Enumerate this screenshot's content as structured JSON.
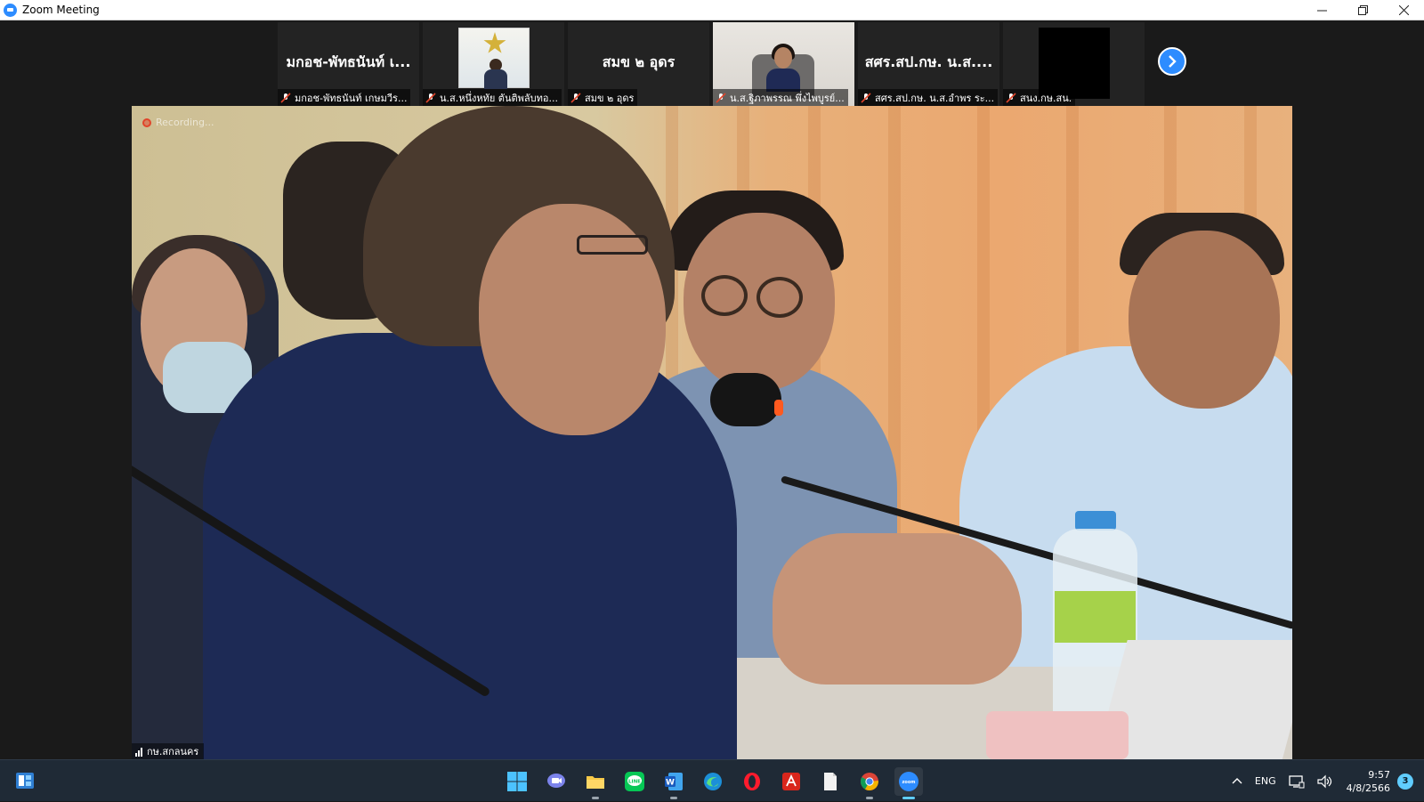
{
  "window": {
    "title": "Zoom Meeting",
    "app_icon": "zoom-icon",
    "controls": [
      "minimize-icon",
      "restore-icon",
      "close-icon"
    ]
  },
  "gallery": {
    "tiles": [
      {
        "big_name": "มกอช-พัทธนันท์ เ...",
        "label": "มกอช-พัทธนันท์ เกษมวีร...",
        "mic": "muted",
        "video": false
      },
      {
        "big_name": "",
        "label": "น.ส.หนึ่งหทัย ตันติพลับทอ...",
        "mic": "muted",
        "video": true
      },
      {
        "big_name": "สมข ๒ อุดร",
        "label": "สมข ๒ อุดร",
        "mic": "muted",
        "video": false
      },
      {
        "big_name": "",
        "label": "น.ส.ฐิภาพรรณ พึ่งไพบูรย์...",
        "mic": "muted",
        "video": true
      },
      {
        "big_name": "สศร.สป.กษ. น.ส....",
        "label": "สศร.สป.กษ. น.ส.อำพร ระ...",
        "mic": "muted",
        "video": false
      },
      {
        "big_name": "",
        "label": "สนง.กษ.สน.",
        "mic": "muted",
        "video": true
      }
    ],
    "next_page_icon": "chevron-right-icon"
  },
  "main_video": {
    "recording_label": "Recording...",
    "speaker_name": "กษ.สกลนคร",
    "recording_color": "#e0452b"
  },
  "taskbar": {
    "apps": [
      "windows-start-icon",
      "teams-chat-icon",
      "file-explorer-icon",
      "line-icon",
      "word-icon",
      "edge-icon",
      "opera-icon",
      "acrobat-icon",
      "file-icon",
      "chrome-icon",
      "zoom-icon"
    ],
    "tray": {
      "language": "ENG",
      "time": "9:57",
      "date": "4/8/2566",
      "notifications": "3"
    }
  },
  "colors": {
    "zoom_blue": "#2d8cff",
    "taskbar_bg": "#1f2a36",
    "muted_red": "#e0452b"
  }
}
